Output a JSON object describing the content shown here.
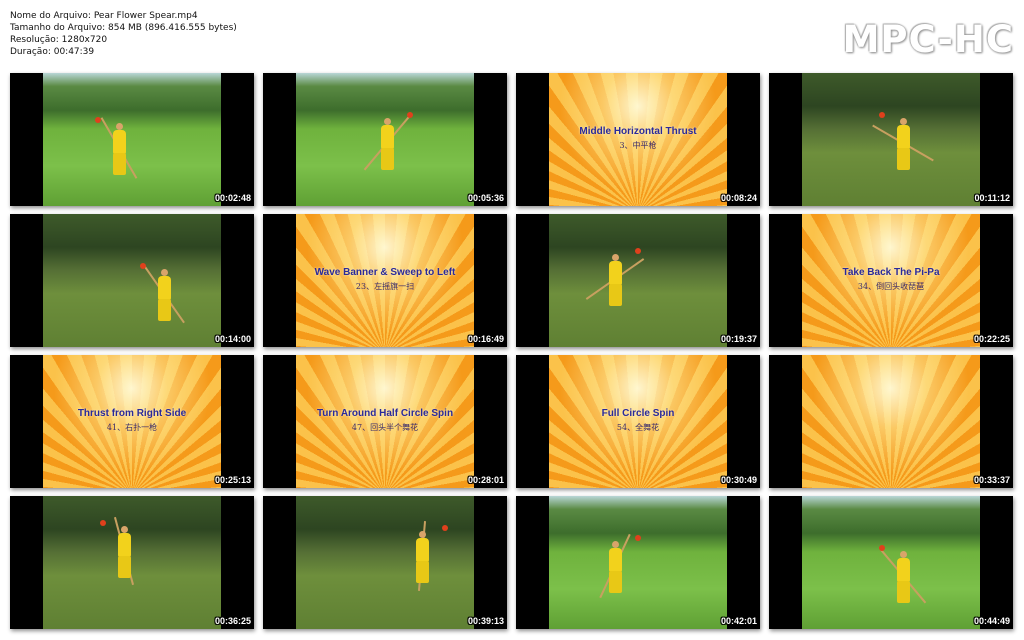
{
  "info": {
    "file_name": "Nome do Arquivo: Pear Flower Spear.mp4",
    "file_size": "Tamanho do Arquivo: 854 MB (896.416.555 bytes)",
    "resolution": "Resolução: 1280x720",
    "duration": "Duração: 00:47:39"
  },
  "logo": "MPC-HC",
  "thumbnails": [
    {
      "time": "00:02:48",
      "scene": "outdoor",
      "title": "",
      "subtitle": ""
    },
    {
      "time": "00:05:36",
      "scene": "outdoor",
      "title": "",
      "subtitle": ""
    },
    {
      "time": "00:08:24",
      "scene": "title",
      "title": "Middle Horizontal Thrust",
      "subtitle": "3、中平枪"
    },
    {
      "time": "00:11:12",
      "scene": "park",
      "title": "",
      "subtitle": ""
    },
    {
      "time": "00:14:00",
      "scene": "park",
      "title": "",
      "subtitle": ""
    },
    {
      "time": "00:16:49",
      "scene": "title",
      "title": "Wave Banner & Sweep to Left",
      "subtitle": "23、左摇旗一扫"
    },
    {
      "time": "00:19:37",
      "scene": "park",
      "title": "",
      "subtitle": ""
    },
    {
      "time": "00:22:25",
      "scene": "title",
      "title": "Take Back The Pi-Pa",
      "subtitle": "34、倒回头收琵琶"
    },
    {
      "time": "00:25:13",
      "scene": "title",
      "title": "Thrust from Right Side",
      "subtitle": "41、右扑一枪"
    },
    {
      "time": "00:28:01",
      "scene": "title",
      "title": "Turn Around Half Circle Spin",
      "subtitle": "47、回头半个舞花"
    },
    {
      "time": "00:30:49",
      "scene": "title",
      "title": "Full Circle Spin",
      "subtitle": "54、全舞花"
    },
    {
      "time": "00:33:37",
      "scene": "title",
      "title": "",
      "subtitle": ""
    },
    {
      "time": "00:36:25",
      "scene": "park",
      "title": "",
      "subtitle": ""
    },
    {
      "time": "00:39:13",
      "scene": "park",
      "title": "",
      "subtitle": ""
    },
    {
      "time": "00:42:01",
      "scene": "outdoor",
      "title": "",
      "subtitle": ""
    },
    {
      "time": "00:44:49",
      "scene": "outdoor",
      "title": "",
      "subtitle": ""
    }
  ]
}
